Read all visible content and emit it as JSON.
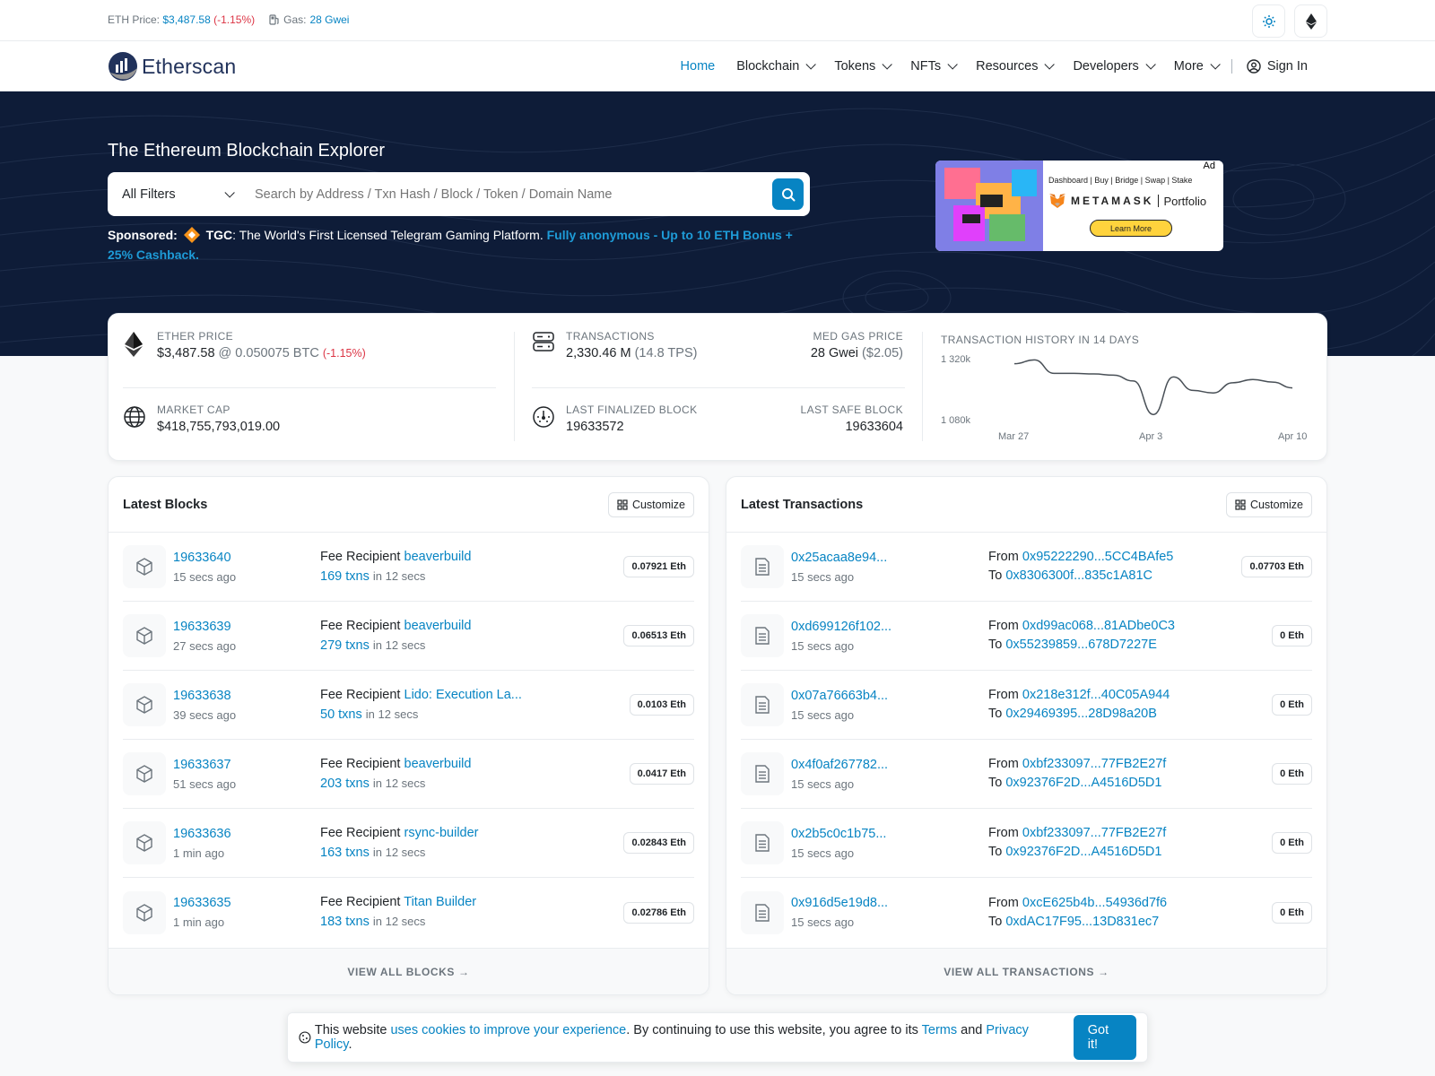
{
  "topbar": {
    "eth_price_label": "ETH Price:",
    "eth_price": "$3,487.58",
    "eth_change": "(-1.15%)",
    "gas_label": "Gas:",
    "gas_value": "28 Gwei"
  },
  "brand": {
    "name": "Etherscan",
    "accent": "#0784c3"
  },
  "nav": {
    "items": [
      "Home",
      "Blockchain",
      "Tokens",
      "NFTs",
      "Resources",
      "Developers",
      "More"
    ],
    "sign_in": "Sign In"
  },
  "hero": {
    "title": "The Ethereum Blockchain Explorer",
    "filter": "All Filters",
    "search_placeholder": "Search by Address / Txn Hash / Block / Token / Domain Name",
    "sponsored_label": "Sponsored:",
    "sponsor_name": "TGC",
    "sponsor_text": ": The World's First Licensed Telegram Gaming Platform. ",
    "sponsor_link": "Fully anonymous - Up to 10 ETH Bonus + 25% Cashback."
  },
  "ad": {
    "tag": "Ad",
    "menu": "Dashboard | Buy | Bridge | Swap | Stake",
    "brand": "METAMASK",
    "product": "Portfolio",
    "cta": "Learn More"
  },
  "stats": {
    "ether_price_label": "ETHER PRICE",
    "ether_price": "$3,487.58",
    "ether_btc": "@ 0.050075 BTC",
    "ether_change": "(-1.15%)",
    "market_cap_label": "MARKET CAP",
    "market_cap": "$418,755,793,019.00",
    "transactions_label": "TRANSACTIONS",
    "transactions": "2,330.46 M",
    "tps": "(14.8 TPS)",
    "gas_label": "MED GAS PRICE",
    "gas": "28 Gwei",
    "gas_usd": "($2.05)",
    "finalized_label": "LAST FINALIZED BLOCK",
    "finalized": "19633572",
    "safe_label": "LAST SAFE BLOCK",
    "safe": "19633604",
    "history_label": "TRANSACTION HISTORY IN 14 DAYS"
  },
  "chart_data": {
    "type": "line",
    "title": "TRANSACTION HISTORY IN 14 DAYS",
    "x": [
      "Mar 27",
      "Mar 28",
      "Mar 29",
      "Mar 30",
      "Mar 31",
      "Apr 1",
      "Apr 2",
      "Apr 3",
      "Apr 4",
      "Apr 5",
      "Apr 6",
      "Apr 7",
      "Apr 8",
      "Apr 9",
      "Apr 10"
    ],
    "x_tick_labels": [
      "Mar 27",
      "Apr 3",
      "Apr 10"
    ],
    "y_tick_labels": [
      "1 320k",
      "1 080k"
    ],
    "values": [
      1300,
      1315,
      1262,
      1262,
      1260,
      1255,
      1232,
      1100,
      1248,
      1195,
      1185,
      1225,
      1238,
      1228,
      1205
    ],
    "ylim": [
      1080,
      1320
    ],
    "grid": false,
    "color": "#495057"
  },
  "latest_blocks": {
    "title": "Latest Blocks",
    "customize": "Customize",
    "fee_label": "Fee Recipient",
    "in_label": "in 12 secs",
    "footer": "VIEW ALL BLOCKS",
    "rows": [
      {
        "block": "19633640",
        "age": "15 secs ago",
        "recipient": "beaverbuild",
        "txns": "169 txns",
        "reward": "0.07921 Eth"
      },
      {
        "block": "19633639",
        "age": "27 secs ago",
        "recipient": "beaverbuild",
        "txns": "279 txns",
        "reward": "0.06513 Eth"
      },
      {
        "block": "19633638",
        "age": "39 secs ago",
        "recipient": "Lido: Execution La...",
        "txns": "50 txns",
        "reward": "0.0103 Eth"
      },
      {
        "block": "19633637",
        "age": "51 secs ago",
        "recipient": "beaverbuild",
        "txns": "203 txns",
        "reward": "0.0417 Eth"
      },
      {
        "block": "19633636",
        "age": "1 min ago",
        "recipient": "rsync-builder",
        "txns": "163 txns",
        "reward": "0.02843 Eth"
      },
      {
        "block": "19633635",
        "age": "1 min ago",
        "recipient": "Titan Builder",
        "txns": "183 txns",
        "reward": "0.02786 Eth"
      }
    ]
  },
  "latest_txns": {
    "title": "Latest Transactions",
    "customize": "Customize",
    "from_label": "From",
    "to_label": "To",
    "footer": "VIEW ALL TRANSACTIONS",
    "rows": [
      {
        "hash": "0x25acaa8e94...",
        "age": "15 secs ago",
        "from": "0x95222290...5CC4BAfe5",
        "to": "0x8306300f...835c1A81C",
        "value": "0.07703 Eth"
      },
      {
        "hash": "0xd699126f102...",
        "age": "15 secs ago",
        "from": "0xd99ac068...81ADbe0C3",
        "to": "0x55239859...678D7227E",
        "value": "0 Eth"
      },
      {
        "hash": "0x07a76663b4...",
        "age": "15 secs ago",
        "from": "0x218e312f...40C05A944",
        "to": "0x29469395...28D98a20B",
        "value": "0 Eth"
      },
      {
        "hash": "0x4f0af267782...",
        "age": "15 secs ago",
        "from": "0xbf233097...77FB2E27f",
        "to": "0x92376F2D...A4516D5D1",
        "value": "0 Eth"
      },
      {
        "hash": "0x2b5c0c1b75...",
        "age": "15 secs ago",
        "from": "0xbf233097...77FB2E27f",
        "to": "0x92376F2D...A4516D5D1",
        "value": "0 Eth"
      },
      {
        "hash": "0x916d5e19d8...",
        "age": "15 secs ago",
        "from": "0xcE625b4b...54936d7f6",
        "to": "0xdAC17F95...13D831ec7",
        "value": "0 Eth"
      }
    ]
  },
  "cookie": {
    "text1": "This website ",
    "link1": "uses cookies to improve your experience",
    "text2": ". By continuing to use this website, you agree to its ",
    "terms": "Terms",
    "and": " and ",
    "privacy": "Privacy Policy",
    "end": ".",
    "button": "Got it!"
  }
}
